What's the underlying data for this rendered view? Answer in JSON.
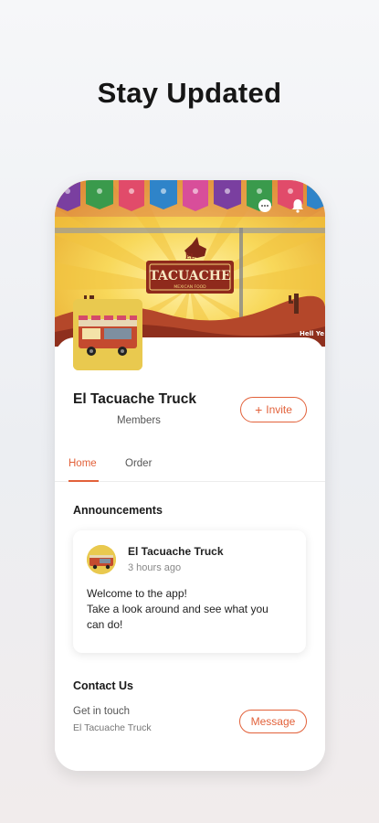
{
  "headline": "Stay Updated",
  "colors": {
    "accent": "#e2613a",
    "text": "#1a1a1a",
    "muted": "#888888"
  },
  "banner": {
    "logo_text_top": "EL",
    "logo_text_main": "TACUACHE",
    "logo_text_sub": "MEXICAN FOOD",
    "corner_text": "Hell Ye",
    "icons": {
      "chat": "chat-icon",
      "notifications": "bell-icon"
    }
  },
  "group": {
    "name": "El Tacuache Truck",
    "members_label": "Members",
    "invite_label": "Invite"
  },
  "tabs": [
    {
      "label": "Home",
      "active": true
    },
    {
      "label": "Order",
      "active": false
    }
  ],
  "announcements": {
    "title": "Announcements",
    "post": {
      "author": "El Tacuache Truck",
      "time": "3 hours ago",
      "body_lines": [
        "Welcome to the app!",
        "Take a look around and see what you",
        "can do!"
      ]
    }
  },
  "contact": {
    "title": "Contact Us",
    "subtitle": "Get in touch",
    "name": "El Tacuache Truck",
    "message_label": "Message"
  }
}
